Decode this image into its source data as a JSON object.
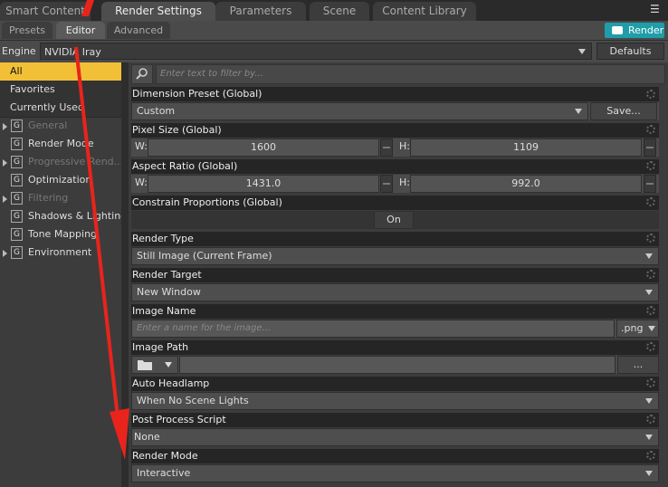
{
  "top_tabs": [
    "Smart Content",
    "Render Settings",
    "Parameters",
    "Scene",
    "Content Library"
  ],
  "sub_tabs": [
    "Presets",
    "Editor",
    "Advanced"
  ],
  "render_button": "Render",
  "engine": {
    "label": "Engine :",
    "value": "NVIDIA Iray",
    "defaults_label": "Defaults"
  },
  "filter_placeholder": "Enter text to filter by...",
  "left_nav": {
    "filters": [
      "All",
      "Favorites",
      "Currently Used"
    ],
    "groups": [
      {
        "label": "General",
        "disabled": true,
        "expandable": true
      },
      {
        "label": "Render Mode",
        "disabled": false,
        "expandable": false
      },
      {
        "label": "Progressive Rend...",
        "disabled": true,
        "expandable": true
      },
      {
        "label": "Optimization",
        "disabled": false,
        "expandable": false
      },
      {
        "label": "Filtering",
        "disabled": true,
        "expandable": true
      },
      {
        "label": "Shadows & Lighting",
        "disabled": false,
        "expandable": false
      },
      {
        "label": "Tone Mapping",
        "disabled": false,
        "expandable": false
      },
      {
        "label": "Environment",
        "disabled": false,
        "expandable": true
      }
    ],
    "group_icon_letter": "G"
  },
  "props": {
    "dimension_preset": {
      "title": "Dimension Preset (Global)",
      "value": "Custom",
      "save_label": "Save..."
    },
    "pixel_size": {
      "title": "Pixel Size (Global)",
      "w_label": "W:",
      "w_value": "1600",
      "h_label": "H:",
      "h_value": "1109"
    },
    "aspect_ratio": {
      "title": "Aspect Ratio (Global)",
      "w_label": "W:",
      "w_value": "1431.0",
      "h_label": "H:",
      "h_value": "992.0"
    },
    "constrain": {
      "title": "Constrain Proportions (Global)",
      "value": "On"
    },
    "render_type": {
      "title": "Render Type",
      "value": "Still Image (Current Frame)"
    },
    "render_target": {
      "title": "Render Target",
      "value": "New Window"
    },
    "image_name": {
      "title": "Image Name",
      "placeholder": "Enter a name for the image...",
      "ext": ".png"
    },
    "image_path": {
      "title": "Image Path",
      "browse_label": "..."
    },
    "auto_headlamp": {
      "title": "Auto Headlamp",
      "value": "When No Scene Lights"
    },
    "post_process": {
      "title": "Post Process Script",
      "value": "None"
    },
    "render_mode": {
      "title": "Render Mode",
      "value": "Interactive"
    }
  },
  "colors": {
    "accent": "#f2c037",
    "render_button": "#1f9da8",
    "arrow": "#e8241c"
  }
}
